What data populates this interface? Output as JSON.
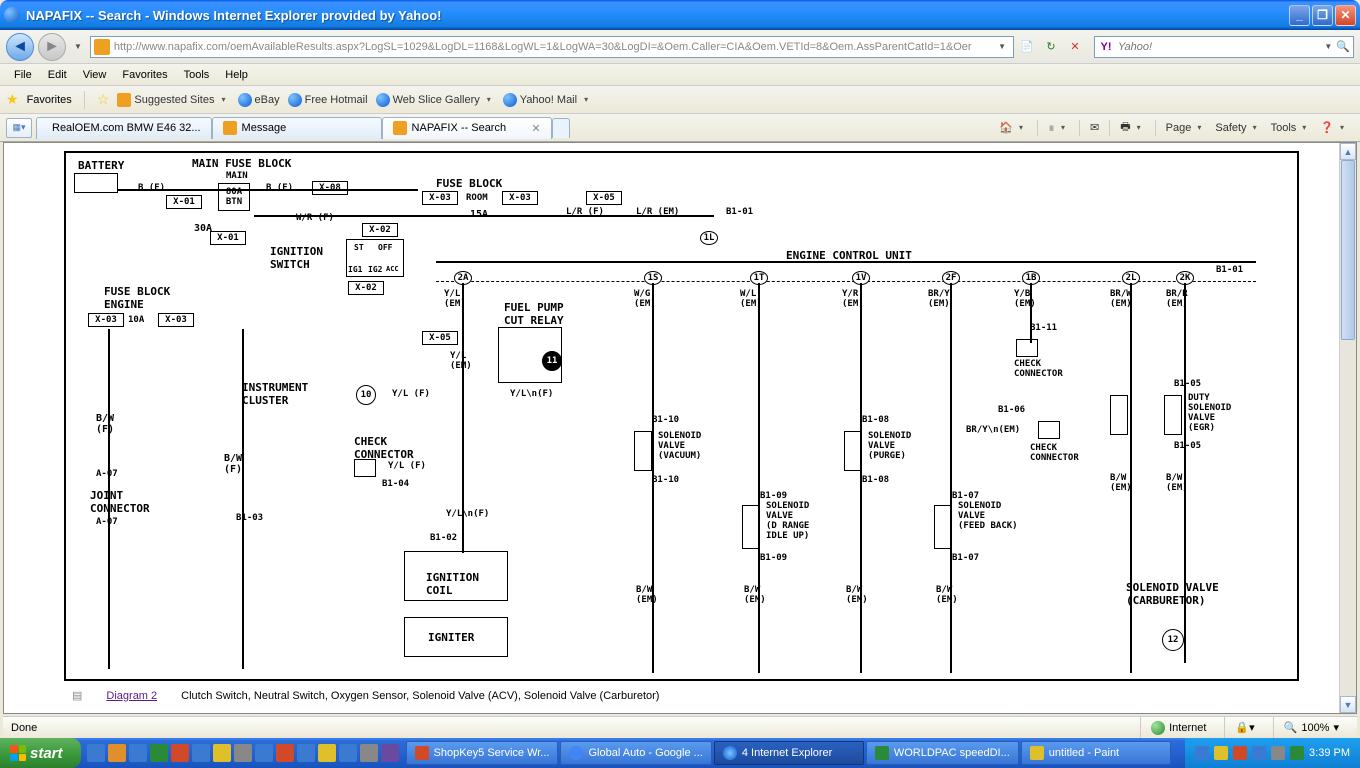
{
  "window": {
    "title": "NAPAFIX -- Search - Windows Internet Explorer provided by Yahoo!"
  },
  "nav": {
    "url": "http://www.napafix.com/oemAvailableResults.aspx?LogSL=1029&LogDL=1168&LogWL=1&LogWA=30&LogDI=&Oem.Caller=CIA&Oem.VETId=8&Oem.AssParentCatId=1&Oer",
    "search_placeholder": "Yahoo!"
  },
  "menus": [
    "File",
    "Edit",
    "View",
    "Favorites",
    "Tools",
    "Help"
  ],
  "favbar": {
    "label": "Favorites",
    "items": [
      "Suggested Sites",
      "eBay",
      "Free Hotmail",
      "Web Slice Gallery",
      "Yahoo! Mail"
    ]
  },
  "tabs": [
    {
      "label": "RealOEM.com   BMW E46 32...",
      "active": false
    },
    {
      "label": "Message",
      "active": false
    },
    {
      "label": "NAPAFIX -- Search",
      "active": true
    }
  ],
  "cmdbar": {
    "page": "Page",
    "safety": "Safety",
    "tools": "Tools"
  },
  "diagram": {
    "battery": "BATTERY",
    "main_fuse_block": "MAIN FUSE BLOCK",
    "main": "MAIN",
    "amp80": "80A\nBTN",
    "amp30": "30A",
    "ignition_switch": "IGNITION\nSWITCH",
    "fuse_block": "FUSE BLOCK",
    "room": "ROOM",
    "amp15": "15A",
    "ecu": "ENGINE CONTROL UNIT",
    "fuse_block_engine": "FUSE BLOCK\nENGINE",
    "amp10": "10A",
    "instrument_cluster": "INSTRUMENT\nCLUSTER",
    "joint_connector": "JOINT\nCONNECTOR",
    "check_connector": "CHECK\nCONNECTOR",
    "fuel_pump": "FUEL PUMP\nCUT RELAY",
    "ignition_coil": "IGNITION\nCOIL",
    "igniter": "IGNITER",
    "sv_vacuum": "SOLENOID\nVALVE\n(VACUUM)",
    "sv_drange": "SOLENOID\nVALVE\n(D RANGE\nIDLE UP)",
    "sv_purge": "SOLENOID\nVALVE\n(PURGE)",
    "sv_feedback": "SOLENOID\nVALVE\n(FEED BACK)",
    "sv_egr": "DUTY\nSOLENOID\nVALVE\n(EGR)",
    "sv_carb": "SOLENOID VALVE\n(CARBURETOR)",
    "wires": {
      "be": "B (E)",
      "wrf": "W/R (F)",
      "lrf": "L/R (F)",
      "lrem": "L/R (EM)",
      "bwf": "B/W\n(F)",
      "bwem": "B/W\n(EM)",
      "ylf": "Y/L (F)",
      "ylem": "Y/L\n(EM)",
      "wgem": "W/G\n(EM)",
      "wlem": "W/L\n(EM)",
      "yrem": "Y/R\n(EM)",
      "bryem": "BR/Y\n(EM)",
      "ybem": "Y/B\n(EM)",
      "brwem": "BR/W\n(EM)",
      "brrem": "BR/R\n(EM)"
    },
    "conns": {
      "x01": "X-01",
      "x02": "X-02",
      "x03": "X-03",
      "x05": "X-05",
      "x08": "X-08",
      "a07": "A-07",
      "b101": "B1-01",
      "b102": "B1-02",
      "b103": "B1-03",
      "b104": "B1-04",
      "b105": "B1-05",
      "b106": "B1-06",
      "b107": "B1-07",
      "b108": "B1-08",
      "b109": "B1-09",
      "b110": "B1-10",
      "b111": "B1-11"
    },
    "pins": {
      "p1l": "1L",
      "p2a": "2A",
      "p1s": "1S",
      "p1t": "1T",
      "p1v": "1V",
      "p2f": "2F",
      "p1b": "1B",
      "p2l": "2L",
      "p2k": "2K",
      "p10": "10",
      "p11": "11",
      "p12": "12"
    },
    "sw": {
      "st": "ST",
      "off": "OFF",
      "ig1": "IG1",
      "ig2": "IG2",
      "acc": "ACC"
    }
  },
  "footer": {
    "link": "Diagram 2",
    "desc": "Clutch Switch, Neutral Switch, Oxygen Sensor, Solenoid Valve (ACV), Solenoid Valve (Carburetor)"
  },
  "status": {
    "done": "Done",
    "zone": "Internet",
    "zoom": "100%"
  },
  "taskbar": {
    "start": "start",
    "tasks": [
      "ShopKey5 Service Wr...",
      "Global Auto - Google ...",
      "4 Internet Explorer",
      "WORLDPAC speedDI...",
      "untitled - Paint"
    ],
    "time": "3:39 PM"
  }
}
